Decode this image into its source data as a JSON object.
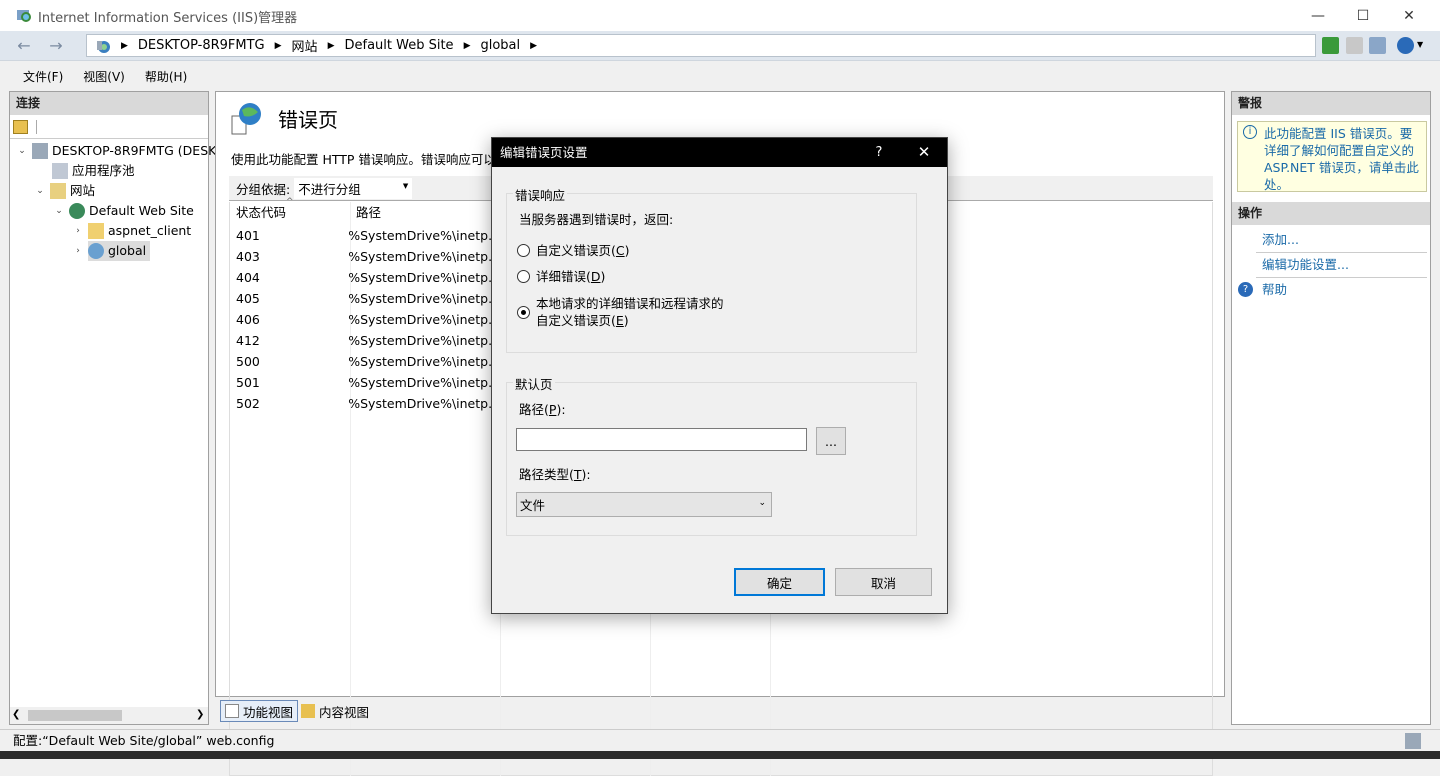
{
  "window": {
    "title": "Internet Information Services (IIS)管理器",
    "minimize": "—",
    "maximize": "☐",
    "close": "✕"
  },
  "address": {
    "crumbs": [
      "DESKTOP-8R9FMTG",
      "网站",
      "Default Web Site",
      "global"
    ]
  },
  "menu": [
    "文件(F)",
    "视图(V)",
    "帮助(H)"
  ],
  "connections": {
    "title": "连接",
    "tree": [
      {
        "label": "DESKTOP-8R9FMTG (DESK"
      },
      {
        "label": "应用程序池"
      },
      {
        "label": "网站"
      },
      {
        "label": "Default Web Site"
      },
      {
        "label": "aspnet_client"
      },
      {
        "label": "global"
      }
    ]
  },
  "feature": {
    "title": "错误页",
    "description": "使用此功能配置 HTTP 错误响应。错误响应可以是",
    "group_label": "分组依据:",
    "group_value": "不进行分组",
    "columns": [
      "状态代码",
      "路径"
    ],
    "rows": [
      {
        "code": "401",
        "path": "%SystemDrive%\\inetp..."
      },
      {
        "code": "403",
        "path": "%SystemDrive%\\inetp..."
      },
      {
        "code": "404",
        "path": "%SystemDrive%\\inetp..."
      },
      {
        "code": "405",
        "path": "%SystemDrive%\\inetp..."
      },
      {
        "code": "406",
        "path": "%SystemDrive%\\inetp..."
      },
      {
        "code": "412",
        "path": "%SystemDrive%\\inetp..."
      },
      {
        "code": "500",
        "path": "%SystemDrive%\\inetp..."
      },
      {
        "code": "501",
        "path": "%SystemDrive%\\inetp..."
      },
      {
        "code": "502",
        "path": "%SystemDrive%\\inetp..."
      }
    ],
    "tabs": [
      "功能视图",
      "内容视图"
    ]
  },
  "alerts": {
    "title": "警报",
    "text": "此功能配置 IIS 错误页。要详细了解如何配置自定义的 ASP.NET 错误页，请单击此处。"
  },
  "actions": {
    "title": "操作",
    "items": [
      "添加...",
      "编辑功能设置...",
      "帮助"
    ]
  },
  "status": {
    "text": "配置:“Default Web Site/global” web.config"
  },
  "dialog": {
    "title": "编辑错误页设置",
    "help": "?",
    "close": "✕",
    "response_group": "错误响应",
    "response_prompt": "当服务器遇到错误时，返回:",
    "options": [
      {
        "pre": "自定义错误页(",
        "key": "C",
        "post": ")",
        "checked": false
      },
      {
        "pre": "详细错误(",
        "key": "D",
        "post": ")",
        "checked": false
      },
      {
        "line1": "本地请求的详细错误和远程请求的",
        "pre": "自定义错误页(",
        "key": "E",
        "post": ")",
        "checked": true
      }
    ],
    "default_group": "默认页",
    "path_label_pre": "路径(",
    "path_label_key": "P",
    "path_label_post": "):",
    "path_value": "",
    "browse": "...",
    "type_label_pre": "路径类型(",
    "type_label_key": "T",
    "type_label_post": "):",
    "type_value": "文件",
    "ok": "确定",
    "cancel": "取消"
  }
}
